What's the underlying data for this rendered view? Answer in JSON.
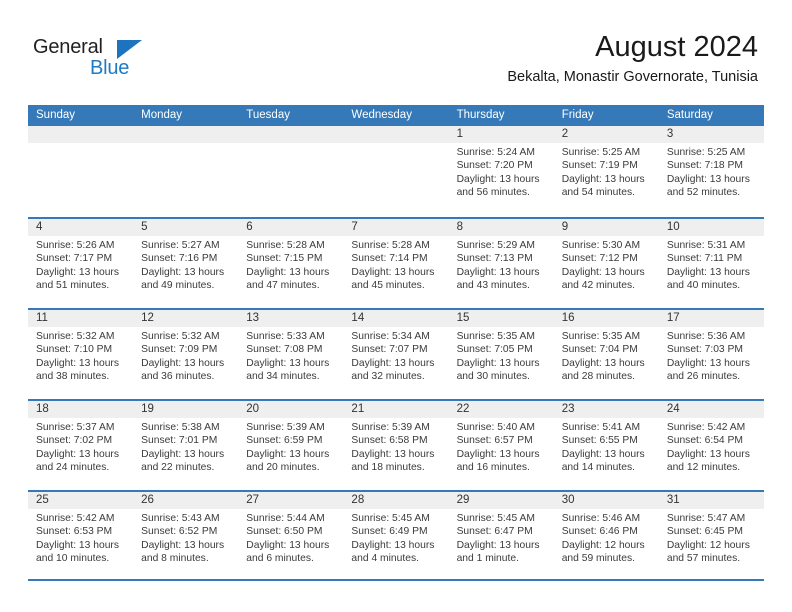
{
  "logo": {
    "word_top": "General",
    "word_bottom": "Blue",
    "triangle_color": "#1e73be",
    "blue_color": "#1f7ac4"
  },
  "header": {
    "title": "August 2024",
    "subtitle": "Bekalta, Monastir Governorate, Tunisia"
  },
  "theme": {
    "header_blue": "#3579b8",
    "day_strip_gray": "#efefef",
    "text_color": "#3b3b3b"
  },
  "weekday_headers": [
    "Sunday",
    "Monday",
    "Tuesday",
    "Wednesday",
    "Thursday",
    "Friday",
    "Saturday"
  ],
  "weeks": [
    [
      {
        "day": "",
        "sunrise": "",
        "sunset": "",
        "daylight_line1": "",
        "daylight_line2": ""
      },
      {
        "day": "",
        "sunrise": "",
        "sunset": "",
        "daylight_line1": "",
        "daylight_line2": ""
      },
      {
        "day": "",
        "sunrise": "",
        "sunset": "",
        "daylight_line1": "",
        "daylight_line2": ""
      },
      {
        "day": "",
        "sunrise": "",
        "sunset": "",
        "daylight_line1": "",
        "daylight_line2": ""
      },
      {
        "day": "1",
        "sunrise": "Sunrise: 5:24 AM",
        "sunset": "Sunset: 7:20 PM",
        "daylight_line1": "Daylight: 13 hours",
        "daylight_line2": "and 56 minutes."
      },
      {
        "day": "2",
        "sunrise": "Sunrise: 5:25 AM",
        "sunset": "Sunset: 7:19 PM",
        "daylight_line1": "Daylight: 13 hours",
        "daylight_line2": "and 54 minutes."
      },
      {
        "day": "3",
        "sunrise": "Sunrise: 5:25 AM",
        "sunset": "Sunset: 7:18 PM",
        "daylight_line1": "Daylight: 13 hours",
        "daylight_line2": "and 52 minutes."
      }
    ],
    [
      {
        "day": "4",
        "sunrise": "Sunrise: 5:26 AM",
        "sunset": "Sunset: 7:17 PM",
        "daylight_line1": "Daylight: 13 hours",
        "daylight_line2": "and 51 minutes."
      },
      {
        "day": "5",
        "sunrise": "Sunrise: 5:27 AM",
        "sunset": "Sunset: 7:16 PM",
        "daylight_line1": "Daylight: 13 hours",
        "daylight_line2": "and 49 minutes."
      },
      {
        "day": "6",
        "sunrise": "Sunrise: 5:28 AM",
        "sunset": "Sunset: 7:15 PM",
        "daylight_line1": "Daylight: 13 hours",
        "daylight_line2": "and 47 minutes."
      },
      {
        "day": "7",
        "sunrise": "Sunrise: 5:28 AM",
        "sunset": "Sunset: 7:14 PM",
        "daylight_line1": "Daylight: 13 hours",
        "daylight_line2": "and 45 minutes."
      },
      {
        "day": "8",
        "sunrise": "Sunrise: 5:29 AM",
        "sunset": "Sunset: 7:13 PM",
        "daylight_line1": "Daylight: 13 hours",
        "daylight_line2": "and 43 minutes."
      },
      {
        "day": "9",
        "sunrise": "Sunrise: 5:30 AM",
        "sunset": "Sunset: 7:12 PM",
        "daylight_line1": "Daylight: 13 hours",
        "daylight_line2": "and 42 minutes."
      },
      {
        "day": "10",
        "sunrise": "Sunrise: 5:31 AM",
        "sunset": "Sunset: 7:11 PM",
        "daylight_line1": "Daylight: 13 hours",
        "daylight_line2": "and 40 minutes."
      }
    ],
    [
      {
        "day": "11",
        "sunrise": "Sunrise: 5:32 AM",
        "sunset": "Sunset: 7:10 PM",
        "daylight_line1": "Daylight: 13 hours",
        "daylight_line2": "and 38 minutes."
      },
      {
        "day": "12",
        "sunrise": "Sunrise: 5:32 AM",
        "sunset": "Sunset: 7:09 PM",
        "daylight_line1": "Daylight: 13 hours",
        "daylight_line2": "and 36 minutes."
      },
      {
        "day": "13",
        "sunrise": "Sunrise: 5:33 AM",
        "sunset": "Sunset: 7:08 PM",
        "daylight_line1": "Daylight: 13 hours",
        "daylight_line2": "and 34 minutes."
      },
      {
        "day": "14",
        "sunrise": "Sunrise: 5:34 AM",
        "sunset": "Sunset: 7:07 PM",
        "daylight_line1": "Daylight: 13 hours",
        "daylight_line2": "and 32 minutes."
      },
      {
        "day": "15",
        "sunrise": "Sunrise: 5:35 AM",
        "sunset": "Sunset: 7:05 PM",
        "daylight_line1": "Daylight: 13 hours",
        "daylight_line2": "and 30 minutes."
      },
      {
        "day": "16",
        "sunrise": "Sunrise: 5:35 AM",
        "sunset": "Sunset: 7:04 PM",
        "daylight_line1": "Daylight: 13 hours",
        "daylight_line2": "and 28 minutes."
      },
      {
        "day": "17",
        "sunrise": "Sunrise: 5:36 AM",
        "sunset": "Sunset: 7:03 PM",
        "daylight_line1": "Daylight: 13 hours",
        "daylight_line2": "and 26 minutes."
      }
    ],
    [
      {
        "day": "18",
        "sunrise": "Sunrise: 5:37 AM",
        "sunset": "Sunset: 7:02 PM",
        "daylight_line1": "Daylight: 13 hours",
        "daylight_line2": "and 24 minutes."
      },
      {
        "day": "19",
        "sunrise": "Sunrise: 5:38 AM",
        "sunset": "Sunset: 7:01 PM",
        "daylight_line1": "Daylight: 13 hours",
        "daylight_line2": "and 22 minutes."
      },
      {
        "day": "20",
        "sunrise": "Sunrise: 5:39 AM",
        "sunset": "Sunset: 6:59 PM",
        "daylight_line1": "Daylight: 13 hours",
        "daylight_line2": "and 20 minutes."
      },
      {
        "day": "21",
        "sunrise": "Sunrise: 5:39 AM",
        "sunset": "Sunset: 6:58 PM",
        "daylight_line1": "Daylight: 13 hours",
        "daylight_line2": "and 18 minutes."
      },
      {
        "day": "22",
        "sunrise": "Sunrise: 5:40 AM",
        "sunset": "Sunset: 6:57 PM",
        "daylight_line1": "Daylight: 13 hours",
        "daylight_line2": "and 16 minutes."
      },
      {
        "day": "23",
        "sunrise": "Sunrise: 5:41 AM",
        "sunset": "Sunset: 6:55 PM",
        "daylight_line1": "Daylight: 13 hours",
        "daylight_line2": "and 14 minutes."
      },
      {
        "day": "24",
        "sunrise": "Sunrise: 5:42 AM",
        "sunset": "Sunset: 6:54 PM",
        "daylight_line1": "Daylight: 13 hours",
        "daylight_line2": "and 12 minutes."
      }
    ],
    [
      {
        "day": "25",
        "sunrise": "Sunrise: 5:42 AM",
        "sunset": "Sunset: 6:53 PM",
        "daylight_line1": "Daylight: 13 hours",
        "daylight_line2": "and 10 minutes."
      },
      {
        "day": "26",
        "sunrise": "Sunrise: 5:43 AM",
        "sunset": "Sunset: 6:52 PM",
        "daylight_line1": "Daylight: 13 hours",
        "daylight_line2": "and 8 minutes."
      },
      {
        "day": "27",
        "sunrise": "Sunrise: 5:44 AM",
        "sunset": "Sunset: 6:50 PM",
        "daylight_line1": "Daylight: 13 hours",
        "daylight_line2": "and 6 minutes."
      },
      {
        "day": "28",
        "sunrise": "Sunrise: 5:45 AM",
        "sunset": "Sunset: 6:49 PM",
        "daylight_line1": "Daylight: 13 hours",
        "daylight_line2": "and 4 minutes."
      },
      {
        "day": "29",
        "sunrise": "Sunrise: 5:45 AM",
        "sunset": "Sunset: 6:47 PM",
        "daylight_line1": "Daylight: 13 hours",
        "daylight_line2": "and 1 minute."
      },
      {
        "day": "30",
        "sunrise": "Sunrise: 5:46 AM",
        "sunset": "Sunset: 6:46 PM",
        "daylight_line1": "Daylight: 12 hours",
        "daylight_line2": "and 59 minutes."
      },
      {
        "day": "31",
        "sunrise": "Sunrise: 5:47 AM",
        "sunset": "Sunset: 6:45 PM",
        "daylight_line1": "Daylight: 12 hours",
        "daylight_line2": "and 57 minutes."
      }
    ]
  ]
}
